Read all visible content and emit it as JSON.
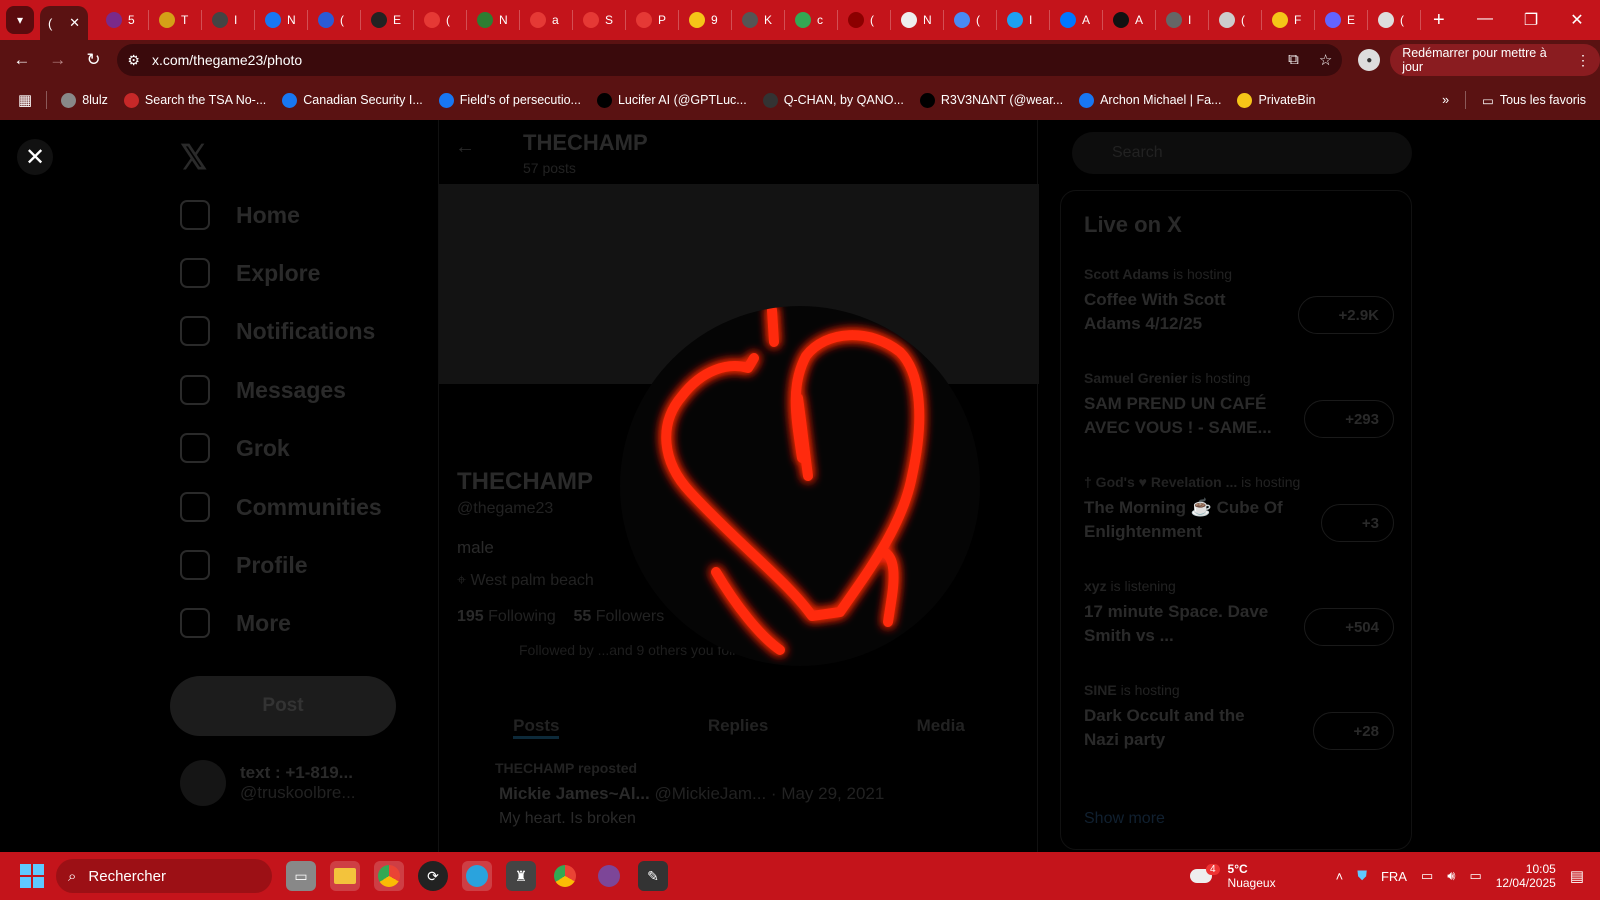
{
  "browser": {
    "url": "x.com/thegame23/photo",
    "update_button": "Redémarrer pour mettre à jour",
    "active_tab_label": "(",
    "tabs": [
      "5",
      "T",
      "I",
      "N",
      "(",
      "E",
      "(",
      "N",
      "a",
      "S",
      "P",
      "9",
      "K",
      "c",
      "(",
      "N",
      "(",
      "I",
      "A",
      "A",
      "I",
      "(",
      "F",
      "E",
      "("
    ],
    "bookmarks": [
      "8lulz",
      "Search the TSA No-...",
      "Canadian Security I...",
      "Field's of persecutio...",
      "Lucifer AI (@GPTLuc...",
      "Q-CHAN, by QANO...",
      "R3V3NΔNT (@wear...",
      "Archon Michael | Fa...",
      "PrivateBin"
    ],
    "all_bookmarks_label": "Tous les favoris"
  },
  "profile": {
    "header_name": "THECHAMP",
    "header_posts": "57 posts",
    "name": "THECHAMP",
    "handle": "@thegame23",
    "bio": "male",
    "location": "West palm beach",
    "following_count": "195",
    "following_label": "Following",
    "followers_count": "55",
    "followers_label": "Followers",
    "followed_by": "Followed by ...and 9 others you follow",
    "tabs": [
      "Posts",
      "Replies",
      "Media"
    ],
    "repost_label": "THECHAMP reposted",
    "tweet_author": "Mickie James~Al...",
    "tweet_handle": "@MickieJam...",
    "tweet_date": "May 29, 2021",
    "tweet_text": "My heart. Is broken"
  },
  "nav": {
    "items": [
      "Home",
      "Explore",
      "Notifications",
      "Messages",
      "Grok",
      "Communities",
      "Profile",
      "More"
    ],
    "post_button": "Post",
    "account_name": "text : +1-819...",
    "account_handle": "@truskoolbre..."
  },
  "sidebar": {
    "search_placeholder": "Search",
    "live_title": "Live on X",
    "live": [
      {
        "host": "Scott Adams",
        "status": "is hosting",
        "title": "Coffee With Scott Adams 4/12/25",
        "count": "+2.9K"
      },
      {
        "host": "Samuel Grenier",
        "status": "is hosting",
        "title": "SAM PREND UN CAFÉ AVEC VOUS ! - SAME...",
        "count": "+293"
      },
      {
        "host": "† God's ♥ Revelation ...",
        "status": "is hosting",
        "title": "The Morning ☕ Cube Of Enlightenment",
        "count": "+3"
      },
      {
        "host": "xyz",
        "status": "is listening",
        "title": "17 minute Space. Dave Smith vs ...",
        "count": "+504"
      },
      {
        "host": "SINE",
        "status": "is hosting",
        "title": "Dark Occult and the Nazi party",
        "count": "+28"
      }
    ],
    "show_more": "Show more"
  },
  "taskbar": {
    "search_label": "Rechercher",
    "weather_temp": "5°C",
    "weather_desc": "Nuageux",
    "weather_badge": "4",
    "language": "FRA",
    "time": "10:05",
    "date": "12/04/2025"
  },
  "icons": {
    "close": "close-icon",
    "heart_drawing": "red-neon-heart"
  },
  "colors": {
    "chrome_red": "#c4141b",
    "chrome_dark": "#5a1212",
    "neon_red": "#ff2a0a"
  }
}
